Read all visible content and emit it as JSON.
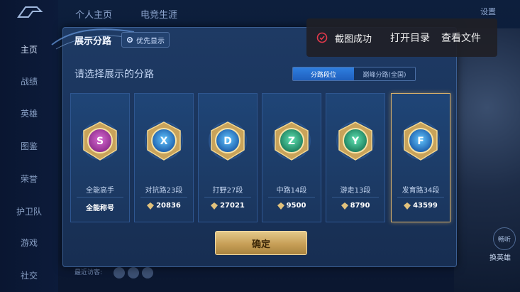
{
  "nav": {
    "items": [
      {
        "label": "主页",
        "active": true
      },
      {
        "label": "战绩"
      },
      {
        "label": "英雄"
      },
      {
        "label": "图鉴"
      },
      {
        "label": "荣誉"
      },
      {
        "label": "护卫队"
      },
      {
        "label": "游戏"
      },
      {
        "label": "社交"
      }
    ]
  },
  "topbar": {
    "tab1": "个人主页",
    "tab2": "电竞生涯",
    "settings": "设置"
  },
  "panel": {
    "title": "展示分路",
    "priority_label": "优先显示",
    "subtitle": "请选择展示的分路",
    "segment_on": "分路段位",
    "segment_off": "巅峰分路(全国)",
    "confirm": "确定"
  },
  "cards": [
    {
      "title": "全能高手",
      "value": "全能称号",
      "colors": [
        "#8a2a8a",
        "#d86bd2"
      ],
      "glyph": "S",
      "icon": "all-round-badge-icon",
      "has_diamond": false
    },
    {
      "title": "对抗路23段",
      "value": "20836",
      "colors": [
        "#1a5aa8",
        "#63c6ff"
      ],
      "glyph": "X",
      "icon": "clash-lane-badge-icon",
      "has_diamond": true
    },
    {
      "title": "打野27段",
      "value": "27021",
      "colors": [
        "#1a5aa8",
        "#63c6ff"
      ],
      "glyph": "D",
      "icon": "jungle-badge-icon",
      "has_diamond": true
    },
    {
      "title": "中路14段",
      "value": "9500",
      "colors": [
        "#1a7a5a",
        "#5fe2b2"
      ],
      "glyph": "Z",
      "icon": "mid-lane-badge-icon",
      "has_diamond": true
    },
    {
      "title": "游走13段",
      "value": "8790",
      "colors": [
        "#1a7a5a",
        "#5fe2b2"
      ],
      "glyph": "Y",
      "icon": "roam-badge-icon",
      "has_diamond": true
    },
    {
      "title": "发育路34段",
      "value": "43599",
      "colors": [
        "#1a5aa8",
        "#63c6ff"
      ],
      "glyph": "F",
      "icon": "farm-lane-badge-icon",
      "has_diamond": true,
      "selected": true
    }
  ],
  "toast": {
    "message": "截图成功",
    "open_dir": "打开目录",
    "view_file": "查看文件"
  },
  "bottom": {
    "recent_visitors": "最近访客:",
    "right_btn1": "畅听",
    "right_btn2": "换英雄"
  }
}
